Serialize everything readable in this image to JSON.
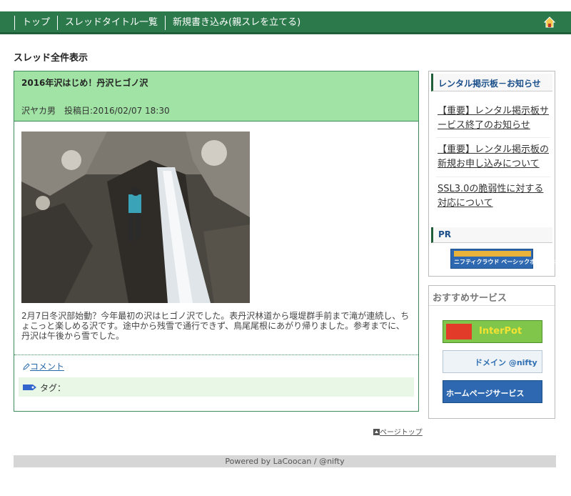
{
  "nav": {
    "items": [
      "トップ",
      "スレッドタイトル一覧",
      "新規書き込み(親スレを立てる)"
    ],
    "home_icon": "home-icon"
  },
  "page": {
    "heading": "スレッド全件表示"
  },
  "thread": {
    "title": "2016年沢はじめ！丹沢ヒゴノ沢",
    "meta": "沢ヤカ男　投稿日:2016/02/07 18:30",
    "body": "2月7日冬沢部始動？今年最初の沢はヒゴノ沢でした。表丹沢林道から堰堤群手前まで滝が連続し、ちょこっと楽しめる沢です。途中から残雪で通行できず、鳥尾尾根にあがり帰りました。参考までに、丹沢は午後から雪でした。",
    "comment_label": "コメント",
    "tag_label": "タグ："
  },
  "sidebar": {
    "notice_title": "レンタル掲示板－お知らせ",
    "notices": [
      "【重要】レンタル掲示板サービス終了のお知らせ",
      "【重要】レンタル掲示板の新規お申し込みについて",
      "SSL3.0の脆弱性に対する対応について"
    ],
    "pr_title": "PR",
    "pr_banner": "ニフティクラウド ベーシックホスティング",
    "recommend_title": "おすすめサービス",
    "banners": [
      "InterPot",
      "ドメイン @nifty",
      "ホームページサービス"
    ]
  },
  "footer": {
    "page_top": "ページトップ",
    "powered": "Powered by LaCoocan / @nifty"
  },
  "colors": {
    "nav_bg": "#2c7a4b",
    "thread_head_bg": "#a0e3a4",
    "border_green": "#3d8a5b"
  }
}
